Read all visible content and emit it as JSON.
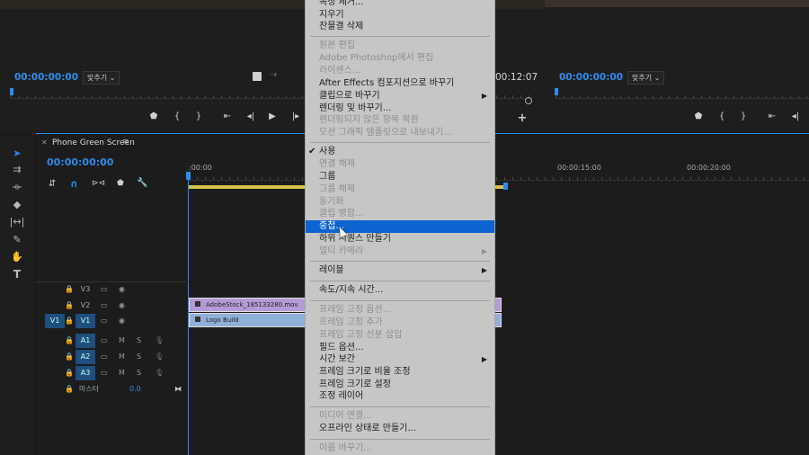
{
  "source_monitor": {
    "timecode": "00:00:00:00",
    "fit": "맞추기",
    "end_timecode": "00:12:07"
  },
  "program_monitor": {
    "timecode": "00:00:00:00",
    "fit": "맞추기"
  },
  "timeline": {
    "sequence_name": "Phone Green Screen",
    "timecode": "00:00:00:00",
    "ruler_labels": [
      ":00:00",
      "00:00:15:00",
      "00:00:20:00"
    ],
    "tracks": {
      "v3": "V3",
      "v2": "V2",
      "v1": "V1",
      "v1_source": "V1",
      "a1": "A1",
      "a2": "A2",
      "a3": "A3",
      "m": "M",
      "s": "S",
      "master": "마스터",
      "master_value": "0.0"
    },
    "clips": {
      "video": "AdobeStock_185133280.mov",
      "graphic": "Logo Build"
    }
  },
  "context_menu": {
    "items": [
      {
        "label": "속성 제거...",
        "disabled": false
      },
      {
        "label": "지우기",
        "disabled": false
      },
      {
        "label": "잔물결 삭제",
        "disabled": false
      },
      {
        "label": "원본 편집",
        "disabled": true
      },
      {
        "label": "Adobe Photoshop에서 편집",
        "disabled": true
      },
      {
        "label": "라이센스...",
        "disabled": true
      },
      {
        "label": "After Effects 컴포지션으로 바꾸기",
        "disabled": false
      },
      {
        "label": "클립으로 바꾸기",
        "disabled": false,
        "submenu": true
      },
      {
        "label": "렌더링 및 바꾸기...",
        "disabled": false
      },
      {
        "label": "렌더링되지 않은 항목 복원",
        "disabled": true
      },
      {
        "label": "모션 그래픽 템플릿으로 내보내기...",
        "disabled": true
      },
      {
        "label": "사용",
        "disabled": false,
        "checked": true
      },
      {
        "label": "연결 해제",
        "disabled": true
      },
      {
        "label": "그룹",
        "disabled": false
      },
      {
        "label": "그룹 해제",
        "disabled": true
      },
      {
        "label": "동기화",
        "disabled": true
      },
      {
        "label": "클립 병합...",
        "disabled": true
      },
      {
        "label": "중첩...",
        "disabled": false,
        "selected": true
      },
      {
        "label": "하위 시퀀스 만들기",
        "disabled": false
      },
      {
        "label": "멀티 카메라",
        "disabled": true,
        "submenu": true
      },
      {
        "label": "레이블",
        "disabled": false,
        "submenu": true
      },
      {
        "label": "속도/지속 시간...",
        "disabled": false
      },
      {
        "label": "프레임 고정 옵션...",
        "disabled": true
      },
      {
        "label": "프레임 고정 추가",
        "disabled": true
      },
      {
        "label": "프레임 고정 선분 삽입",
        "disabled": true
      },
      {
        "label": "필드 옵션...",
        "disabled": false
      },
      {
        "label": "시간 보간",
        "disabled": false,
        "submenu": true
      },
      {
        "label": "프레임 크기로 비율 조정",
        "disabled": false
      },
      {
        "label": "프레임 크기로 설정",
        "disabled": false
      },
      {
        "label": "조정 레이어",
        "disabled": false
      },
      {
        "label": "미디어 연결...",
        "disabled": true
      },
      {
        "label": "오프라인 상태로 만들기...",
        "disabled": false
      },
      {
        "label": "이름 바꾸기...",
        "disabled": true
      }
    ]
  },
  "icons": {
    "check": "✔",
    "arrow": "▶"
  },
  "colors": {
    "accent": "#2d8ceb",
    "clip_video": "#b49bd6",
    "clip_graphic": "#8fb0d9",
    "menu_bg": "#c6c6c6",
    "menu_selected": "#0d63cf"
  }
}
